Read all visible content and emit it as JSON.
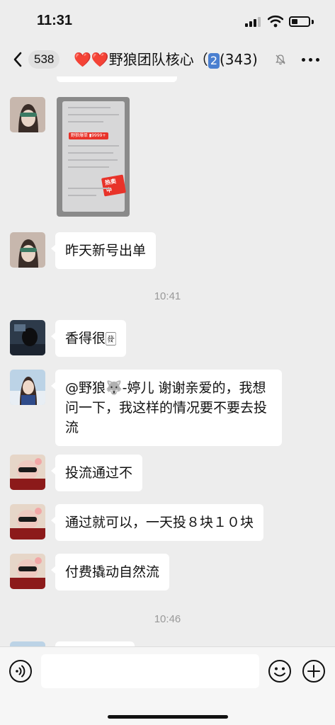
{
  "status_bar": {
    "time": "11:31",
    "battery_level": 0.35
  },
  "nav": {
    "unread_count": "538",
    "title_prefix": "❤️❤️野狼团队核心（",
    "title_badge": "2",
    "title_suffix": "(343)"
  },
  "messages": [
    {
      "type": "image",
      "image_labels": {
        "promo": "野狼爆单 ▮9999+",
        "live": "热卖中"
      }
    },
    {
      "type": "text",
      "text": "昨天新号出单"
    },
    {
      "type": "time",
      "text": "10:41"
    },
    {
      "type": "text",
      "text": "香得很🀅"
    },
    {
      "type": "text",
      "text": "@野狼🐺-婷儿 谢谢亲爱的，我想问一下，我这样的情况要不要去投流"
    },
    {
      "type": "text",
      "text": "投流通过不"
    },
    {
      "type": "text",
      "text": "通过就可以，一天投８块１０块"
    },
    {
      "type": "text",
      "text": "付费撬动自然流"
    },
    {
      "type": "time",
      "text": "10:46"
    }
  ],
  "input": {
    "placeholder": ""
  },
  "colors": {
    "background": "#ededed",
    "bubble": "#ffffff",
    "badge_blue": "#4a7fd0"
  }
}
